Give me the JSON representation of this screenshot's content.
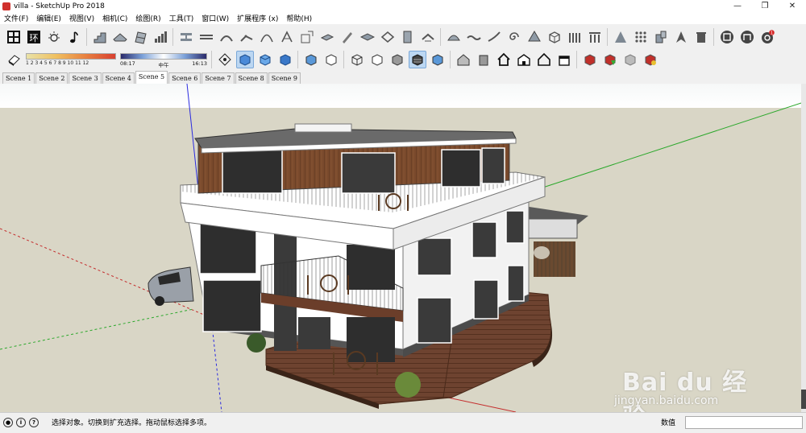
{
  "window": {
    "title": "villa - SketchUp Pro 2018",
    "minimize": "—",
    "maximize": "❐",
    "close": "✕"
  },
  "menu": [
    "文件(F)",
    "编辑(E)",
    "视图(V)",
    "相机(C)",
    "绘图(R)",
    "工具(T)",
    "窗口(W)",
    "扩展程序 (x)",
    "帮助(H)"
  ],
  "shadow": {
    "ticks": "1  2  3  4  5  6  7  8  9  10 11 12"
  },
  "time": {
    "start": "08:17",
    "mid": "中午",
    "end": "16:13"
  },
  "scenes": [
    "Scene 1",
    "Scene 2",
    "Scene 3",
    "Scene 4",
    "Scene 5",
    "Scene 6",
    "Scene 7",
    "Scene 8",
    "Scene 9"
  ],
  "active_scene": "Scene 5",
  "status": {
    "message": "选择对象。切换到扩充选择。拖动鼠标选择多项。",
    "measure_label": "数值",
    "icon_geo": "●",
    "icon_info": "i",
    "icon_help": "?"
  },
  "watermark": {
    "logo": "Bai du 经验",
    "url": "jingyan.baidu.com"
  },
  "colors": {
    "sky": "#ffffff",
    "ground": "#d9d6c6",
    "wood": "#7a4a2c",
    "wall": "#ffffff",
    "deck": "#6b3e2a"
  }
}
